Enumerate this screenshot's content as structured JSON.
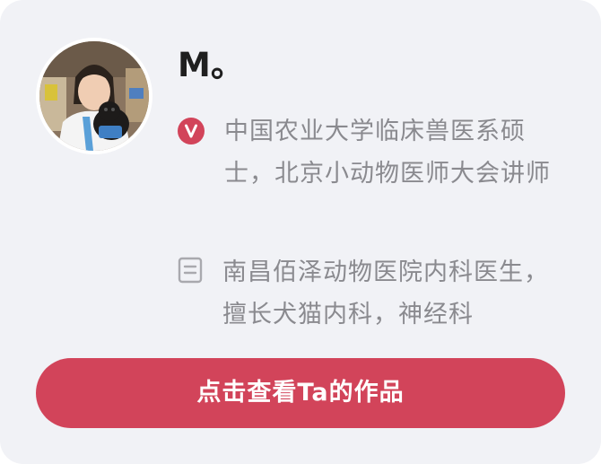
{
  "profile": {
    "name": "M。",
    "certification_text": "中国农业大学临床兽医系硕士，北京小动物医师大会讲师",
    "description_text": "南昌佰泽动物医院内科医生，擅长犬猫内科，神经科"
  },
  "icons": {
    "verified": "verified-v-icon",
    "description": "document-lines-icon"
  },
  "actions": {
    "view_works_label": "点击查看Ta的作品"
  },
  "colors": {
    "card_background": "#f1f2f6",
    "accent": "#d2445a",
    "name_text": "#1f1f1f",
    "secondary_text": "#8a8a8f"
  }
}
